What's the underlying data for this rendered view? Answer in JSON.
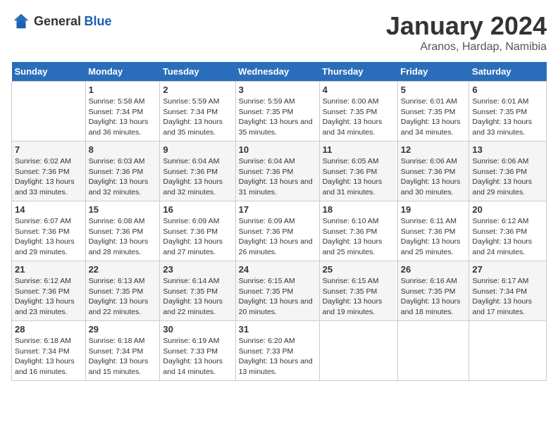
{
  "logo": {
    "general": "General",
    "blue": "Blue"
  },
  "header": {
    "month": "January 2024",
    "location": "Aranos, Hardap, Namibia"
  },
  "weekdays": [
    "Sunday",
    "Monday",
    "Tuesday",
    "Wednesday",
    "Thursday",
    "Friday",
    "Saturday"
  ],
  "weeks": [
    [
      {
        "day": "",
        "sunrise": "",
        "sunset": "",
        "daylight": ""
      },
      {
        "day": "1",
        "sunrise": "Sunrise: 5:58 AM",
        "sunset": "Sunset: 7:34 PM",
        "daylight": "Daylight: 13 hours and 36 minutes."
      },
      {
        "day": "2",
        "sunrise": "Sunrise: 5:59 AM",
        "sunset": "Sunset: 7:34 PM",
        "daylight": "Daylight: 13 hours and 35 minutes."
      },
      {
        "day": "3",
        "sunrise": "Sunrise: 5:59 AM",
        "sunset": "Sunset: 7:35 PM",
        "daylight": "Daylight: 13 hours and 35 minutes."
      },
      {
        "day": "4",
        "sunrise": "Sunrise: 6:00 AM",
        "sunset": "Sunset: 7:35 PM",
        "daylight": "Daylight: 13 hours and 34 minutes."
      },
      {
        "day": "5",
        "sunrise": "Sunrise: 6:01 AM",
        "sunset": "Sunset: 7:35 PM",
        "daylight": "Daylight: 13 hours and 34 minutes."
      },
      {
        "day": "6",
        "sunrise": "Sunrise: 6:01 AM",
        "sunset": "Sunset: 7:35 PM",
        "daylight": "Daylight: 13 hours and 33 minutes."
      }
    ],
    [
      {
        "day": "7",
        "sunrise": "Sunrise: 6:02 AM",
        "sunset": "Sunset: 7:36 PM",
        "daylight": "Daylight: 13 hours and 33 minutes."
      },
      {
        "day": "8",
        "sunrise": "Sunrise: 6:03 AM",
        "sunset": "Sunset: 7:36 PM",
        "daylight": "Daylight: 13 hours and 32 minutes."
      },
      {
        "day": "9",
        "sunrise": "Sunrise: 6:04 AM",
        "sunset": "Sunset: 7:36 PM",
        "daylight": "Daylight: 13 hours and 32 minutes."
      },
      {
        "day": "10",
        "sunrise": "Sunrise: 6:04 AM",
        "sunset": "Sunset: 7:36 PM",
        "daylight": "Daylight: 13 hours and 31 minutes."
      },
      {
        "day": "11",
        "sunrise": "Sunrise: 6:05 AM",
        "sunset": "Sunset: 7:36 PM",
        "daylight": "Daylight: 13 hours and 31 minutes."
      },
      {
        "day": "12",
        "sunrise": "Sunrise: 6:06 AM",
        "sunset": "Sunset: 7:36 PM",
        "daylight": "Daylight: 13 hours and 30 minutes."
      },
      {
        "day": "13",
        "sunrise": "Sunrise: 6:06 AM",
        "sunset": "Sunset: 7:36 PM",
        "daylight": "Daylight: 13 hours and 29 minutes."
      }
    ],
    [
      {
        "day": "14",
        "sunrise": "Sunrise: 6:07 AM",
        "sunset": "Sunset: 7:36 PM",
        "daylight": "Daylight: 13 hours and 29 minutes."
      },
      {
        "day": "15",
        "sunrise": "Sunrise: 6:08 AM",
        "sunset": "Sunset: 7:36 PM",
        "daylight": "Daylight: 13 hours and 28 minutes."
      },
      {
        "day": "16",
        "sunrise": "Sunrise: 6:09 AM",
        "sunset": "Sunset: 7:36 PM",
        "daylight": "Daylight: 13 hours and 27 minutes."
      },
      {
        "day": "17",
        "sunrise": "Sunrise: 6:09 AM",
        "sunset": "Sunset: 7:36 PM",
        "daylight": "Daylight: 13 hours and 26 minutes."
      },
      {
        "day": "18",
        "sunrise": "Sunrise: 6:10 AM",
        "sunset": "Sunset: 7:36 PM",
        "daylight": "Daylight: 13 hours and 25 minutes."
      },
      {
        "day": "19",
        "sunrise": "Sunrise: 6:11 AM",
        "sunset": "Sunset: 7:36 PM",
        "daylight": "Daylight: 13 hours and 25 minutes."
      },
      {
        "day": "20",
        "sunrise": "Sunrise: 6:12 AM",
        "sunset": "Sunset: 7:36 PM",
        "daylight": "Daylight: 13 hours and 24 minutes."
      }
    ],
    [
      {
        "day": "21",
        "sunrise": "Sunrise: 6:12 AM",
        "sunset": "Sunset: 7:36 PM",
        "daylight": "Daylight: 13 hours and 23 minutes."
      },
      {
        "day": "22",
        "sunrise": "Sunrise: 6:13 AM",
        "sunset": "Sunset: 7:35 PM",
        "daylight": "Daylight: 13 hours and 22 minutes."
      },
      {
        "day": "23",
        "sunrise": "Sunrise: 6:14 AM",
        "sunset": "Sunset: 7:35 PM",
        "daylight": "Daylight: 13 hours and 22 minutes."
      },
      {
        "day": "24",
        "sunrise": "Sunrise: 6:15 AM",
        "sunset": "Sunset: 7:35 PM",
        "daylight": "Daylight: 13 hours and 20 minutes."
      },
      {
        "day": "25",
        "sunrise": "Sunrise: 6:15 AM",
        "sunset": "Sunset: 7:35 PM",
        "daylight": "Daylight: 13 hours and 19 minutes."
      },
      {
        "day": "26",
        "sunrise": "Sunrise: 6:16 AM",
        "sunset": "Sunset: 7:35 PM",
        "daylight": "Daylight: 13 hours and 18 minutes."
      },
      {
        "day": "27",
        "sunrise": "Sunrise: 6:17 AM",
        "sunset": "Sunset: 7:34 PM",
        "daylight": "Daylight: 13 hours and 17 minutes."
      }
    ],
    [
      {
        "day": "28",
        "sunrise": "Sunrise: 6:18 AM",
        "sunset": "Sunset: 7:34 PM",
        "daylight": "Daylight: 13 hours and 16 minutes."
      },
      {
        "day": "29",
        "sunrise": "Sunrise: 6:18 AM",
        "sunset": "Sunset: 7:34 PM",
        "daylight": "Daylight: 13 hours and 15 minutes."
      },
      {
        "day": "30",
        "sunrise": "Sunrise: 6:19 AM",
        "sunset": "Sunset: 7:33 PM",
        "daylight": "Daylight: 13 hours and 14 minutes."
      },
      {
        "day": "31",
        "sunrise": "Sunrise: 6:20 AM",
        "sunset": "Sunset: 7:33 PM",
        "daylight": "Daylight: 13 hours and 13 minutes."
      },
      {
        "day": "",
        "sunrise": "",
        "sunset": "",
        "daylight": ""
      },
      {
        "day": "",
        "sunrise": "",
        "sunset": "",
        "daylight": ""
      },
      {
        "day": "",
        "sunrise": "",
        "sunset": "",
        "daylight": ""
      }
    ]
  ]
}
